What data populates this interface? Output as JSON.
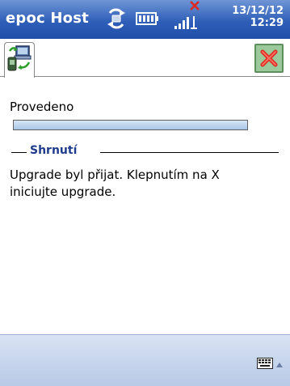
{
  "titlebar": {
    "app_title": "epoc Host",
    "date": "13/12/12",
    "time": "12:29",
    "icons": [
      "sync-icon",
      "battery-icon",
      "signal-icon",
      "no-connection-icon"
    ]
  },
  "toolbar": {
    "tab_icon": "devices-sync-icon",
    "close_icon": "close-icon"
  },
  "content": {
    "status_label": "Provedeno",
    "progress_value": 1.0,
    "section_title": "Shrnutí",
    "summary_text": "Upgrade byl přijat. Klepnutím na X iniciujte upgrade."
  },
  "bottom": {
    "keyboard_icon": "keyboard-icon"
  },
  "colors": {
    "titlebar": "#2f5fb8",
    "section_title": "#1f3b8e",
    "close_button": "#9bc99b",
    "close_x": "#e0281e",
    "progress": "#aac6e8"
  }
}
